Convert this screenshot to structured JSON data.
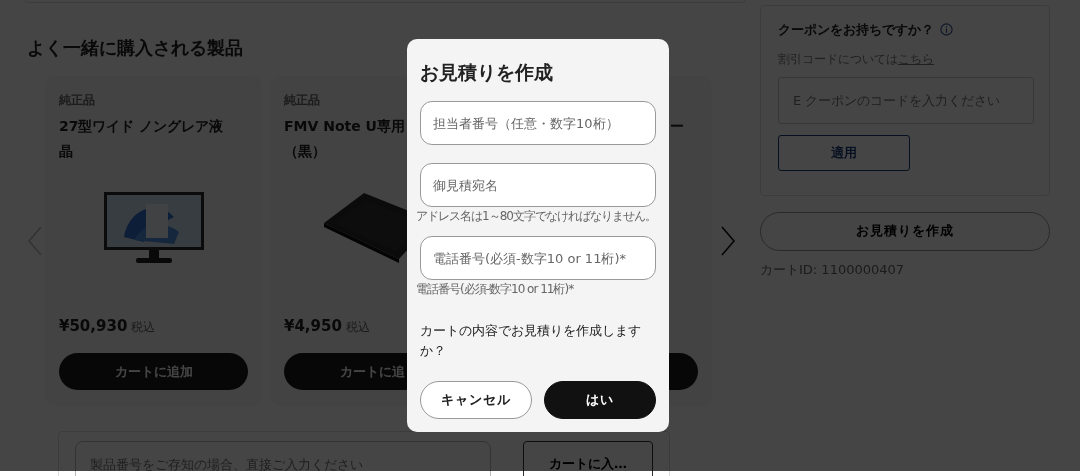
{
  "section_title": "よく一緒に購入される製品",
  "carousel": {
    "prev_disabled": true,
    "products": [
      {
        "tag": "純正品",
        "title_lines": [
          "27型ワイド ノングレア液",
          "晶"
        ],
        "price": "¥50,930",
        "tax_label": "税込",
        "button": "カートに追加"
      },
      {
        "tag": "純正品",
        "title_lines": [
          "FMV Note U専用",
          "（黒）"
        ],
        "price": "¥4,950",
        "tax_label": "税込",
        "button": "カートに追"
      },
      {
        "title_lines": [
          "ー"
        ]
      }
    ]
  },
  "quick_order": {
    "placeholder": "製品番号をご存知の場合、直接ご入力ください",
    "button": "カートに入…"
  },
  "coupon": {
    "title": "クーポンをお持ちですか？",
    "note": "割引コードについては",
    "link": "こちら",
    "placeholder": "E クーポンのコードを入力ください",
    "button": "適用"
  },
  "quote_button": "お見積りを作成",
  "cart_id": "カートID: 1100000407",
  "modal": {
    "title": "お見積りを作成",
    "fields": [
      {
        "placeholder": "担当者番号（任意・数字10桁）"
      },
      {
        "placeholder": "御見積宛名",
        "hint": "アドレス名は1～80文字でなければなりません。"
      },
      {
        "placeholder": "電話番号(必須-数字10 or 11桁)*",
        "hint": "電話番号(必須-数字10 or 11桁)*"
      }
    ],
    "message": "カートの内容でお見積りを作成しますか？",
    "buttons": [
      {
        "kind": "outline",
        "label": "キャンセル"
      },
      {
        "kind": "primary",
        "label": "はい"
      }
    ]
  }
}
